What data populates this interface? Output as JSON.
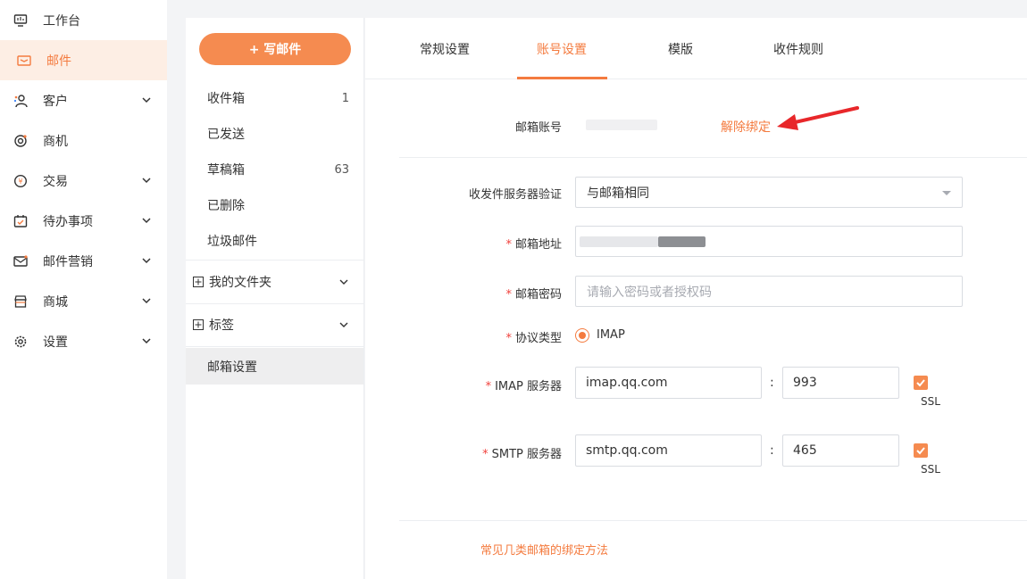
{
  "sidebar": {
    "items": [
      {
        "label": "工作台",
        "icon": "monitor-icon",
        "expandable": false
      },
      {
        "label": "邮件",
        "icon": "mail-icon",
        "expandable": false,
        "active": true
      },
      {
        "label": "客户",
        "icon": "customer-icon",
        "expandable": true
      },
      {
        "label": "商机",
        "icon": "target-icon",
        "expandable": false
      },
      {
        "label": "交易",
        "icon": "transaction-icon",
        "expandable": true
      },
      {
        "label": "待办事项",
        "icon": "calendar-icon",
        "expandable": true
      },
      {
        "label": "邮件营销",
        "icon": "mail-marketing-icon",
        "expandable": true
      },
      {
        "label": "商城",
        "icon": "store-icon",
        "expandable": true
      },
      {
        "label": "设置",
        "icon": "gear-icon",
        "expandable": true
      }
    ]
  },
  "folders": {
    "compose_label": "+ 写邮件",
    "items": [
      {
        "label": "收件箱",
        "count": "1"
      },
      {
        "label": "已发送",
        "count": ""
      },
      {
        "label": "草稿箱",
        "count": "63"
      },
      {
        "label": "已删除",
        "count": ""
      },
      {
        "label": "垃圾邮件",
        "count": ""
      }
    ],
    "groups": [
      {
        "label": "我的文件夹"
      },
      {
        "label": "标签"
      }
    ],
    "settings_label": "邮箱设置"
  },
  "tabs": [
    {
      "label": "常规设置"
    },
    {
      "label": "账号设置",
      "active": true
    },
    {
      "label": "模版"
    },
    {
      "label": "收件规则"
    }
  ],
  "form": {
    "account_label": "邮箱账号",
    "unbind_label": "解除绑定",
    "verify_label": "收发件服务器验证",
    "verify_value": "与邮箱相同",
    "address_label": "邮箱地址",
    "password_label": "邮箱密码",
    "password_placeholder": "请输入密码或者授权码",
    "protocol_label": "协议类型",
    "protocol_value": "IMAP",
    "imap_label": "IMAP 服务器",
    "imap_host": "imap.qq.com",
    "imap_port": "993",
    "smtp_label": "SMTP 服务器",
    "smtp_host": "smtp.qq.com",
    "smtp_port": "465",
    "ssl_label": "SSL",
    "colon": ":",
    "required_mark": "*",
    "help_link": "常见几类邮箱的绑定方法"
  },
  "colors": {
    "accent": "#f47b3f",
    "accent_bg": "#fdeee4",
    "annotation_arrow": "#e8272a"
  }
}
